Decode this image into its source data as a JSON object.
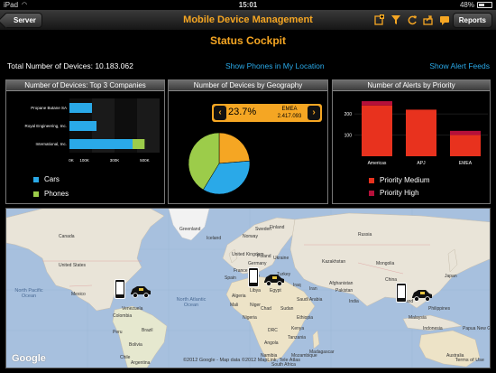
{
  "status_bar": {
    "carrier": "iPad",
    "time": "15:01",
    "battery": "48%"
  },
  "nav": {
    "back_label": "Server",
    "title": "Mobile Device Management",
    "reports_label": "Reports",
    "icons": [
      "add-icon",
      "filter-icon",
      "refresh-icon",
      "share-icon",
      "comment-icon",
      "help-icon"
    ]
  },
  "page": {
    "title": "Status Cockpit",
    "total_devices": "Total Number of Devices: 10.183.062",
    "link_phones": "Show Phones in My Location",
    "link_alerts": "Show Alert Feeds"
  },
  "panel_companies": {
    "title": "Number of Devices: Top 3 Companies",
    "legend": [
      {
        "label": "Cars",
        "color": "#2aa9e8"
      },
      {
        "label": "Phones",
        "color": "#9ccc4a"
      }
    ]
  },
  "panel_geography": {
    "title": "Number of Devices by Geography",
    "selected_pct": "23.7%",
    "selected_region": "EMEA",
    "selected_count": "2.417.093",
    "arrow_left": "‹",
    "arrow_right": "›"
  },
  "panel_alerts": {
    "title": "Number of Alerts by Priority",
    "legend": [
      {
        "label": "Priority Medium",
        "color": "#e8321e"
      },
      {
        "label": "Priority High",
        "color": "#b5103a"
      }
    ]
  },
  "chart_data": [
    {
      "type": "bar",
      "orientation": "horizontal",
      "stacked": true,
      "categories": [
        "Propane Butane SA",
        "Royal Engineering, Inc.",
        "International, Inc."
      ],
      "series": [
        {
          "name": "Cars",
          "values": [
            150000,
            180000,
            420000
          ]
        },
        {
          "name": "Phones",
          "values": [
            0,
            0,
            80000
          ]
        }
      ],
      "xticks": [
        "0K",
        "100K",
        "300K",
        "500K"
      ],
      "xlim": [
        0,
        600000
      ],
      "grid": true
    },
    {
      "type": "pie",
      "categories": [
        "EMEA",
        "Americas",
        "APJ"
      ],
      "values": [
        23.7,
        35,
        41.3
      ],
      "colors": [
        "#f5a623",
        "#2aa9e8",
        "#9ccc4a"
      ]
    },
    {
      "type": "bar",
      "stacked": true,
      "categories": [
        "Americas",
        "APJ",
        "EMEA"
      ],
      "series": [
        {
          "name": "Priority Medium",
          "values": [
            240,
            220,
            100
          ]
        },
        {
          "name": "Priority High",
          "values": [
            20,
            0,
            20
          ]
        }
      ],
      "yticks": [
        "100",
        "200"
      ],
      "ylim": [
        0,
        290
      ],
      "grid": true
    }
  ],
  "map": {
    "ocean_labels": [
      "North Pacific Ocean",
      "North Atlantic Ocean"
    ],
    "country_labels": [
      "Canada",
      "United States",
      "Mexico",
      "Venezuela",
      "Colombia",
      "Peru",
      "Brazil",
      "Bolivia",
      "Chile",
      "Argentina",
      "Greenland",
      "Iceland",
      "Sweden",
      "Finland",
      "Norway",
      "Russia",
      "United Kingdom",
      "Poland",
      "Germany",
      "France",
      "Spain",
      "Italy",
      "Ukraine",
      "Kazakhstan",
      "Mongolia",
      "China",
      "Japan",
      "India",
      "Pakistan",
      "Afghanistan",
      "Iran",
      "Iraq",
      "Saudi Arabia",
      "Turkey",
      "Egypt",
      "Libya",
      "Algeria",
      "Mali",
      "Niger",
      "Chad",
      "Sudan",
      "Nigeria",
      "Ethiopia",
      "Kenya",
      "DRC",
      "Tanzania",
      "Angola",
      "Namibia",
      "Thailand",
      "Philippines",
      "Indonesia",
      "Papua New Guinea",
      "Australia",
      "South Africa",
      "Madagascar",
      "Mozambique",
      "Malaysia"
    ],
    "google": "Google",
    "attribution": "©2012 Google - Map data ©2012 MapLink, Tele Atlas",
    "terms": "Terms of Use"
  }
}
